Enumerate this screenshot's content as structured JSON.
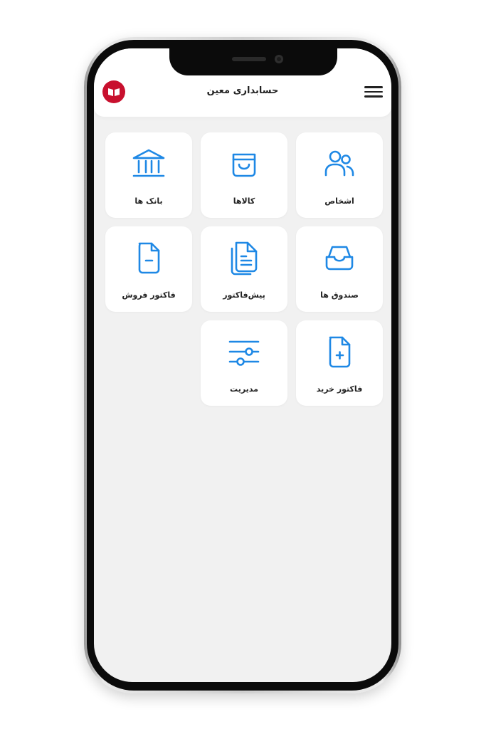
{
  "app": {
    "title": "حسابداری معین",
    "accent": "#1e88e5",
    "logo_color": "#c8102e"
  },
  "menu": {
    "icon": "hamburger-menu-icon"
  },
  "tiles": [
    {
      "label": "اشخاص",
      "icon": "users-icon"
    },
    {
      "label": "کالاها",
      "icon": "shopping-bag-icon"
    },
    {
      "label": "بانک ها",
      "icon": "bank-icon"
    },
    {
      "label": "صندوق ها",
      "icon": "inbox-tray-icon"
    },
    {
      "label": "پیش‌فاکتور",
      "icon": "documents-icon"
    },
    {
      "label": "فاکتور فروش",
      "icon": "file-minus-icon"
    },
    {
      "label": "فاکتور خرید",
      "icon": "file-plus-icon"
    },
    {
      "label": "مدیریت",
      "icon": "sliders-icon"
    }
  ]
}
